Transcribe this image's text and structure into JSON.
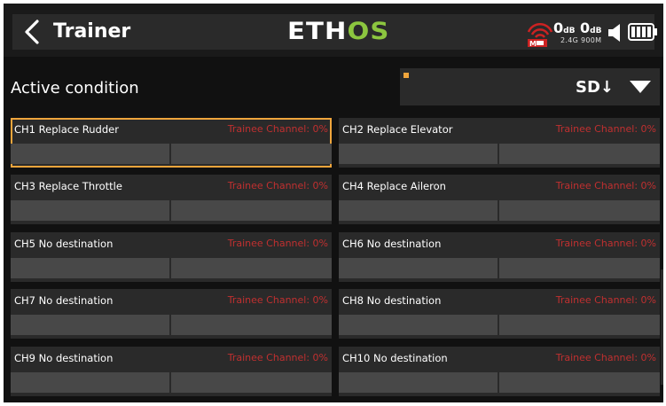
{
  "header": {
    "title": "Trainer",
    "logo_part1": "ETH",
    "logo_part2": "OS",
    "rx1_db_value": "0",
    "rx1_db_unit": "dB",
    "rx2_db_value": "0",
    "rx2_db_unit": "dB",
    "rx_bands": "2.4G 900M",
    "icons": [
      "back-arrow-icon",
      "signal-icon",
      "speaker-icon",
      "battery-icon"
    ]
  },
  "condition": {
    "label": "Active condition",
    "value": "SD↓"
  },
  "colors": {
    "accent": "#f0a53c",
    "trainee_text": "#c03030",
    "logo_green": "#8cc63f",
    "card_bg": "#2a2a2a",
    "bar_bg": "#484848"
  },
  "channels": [
    {
      "label": "CH1 Replace Rudder",
      "trainee": "Trainee Channel: 0%",
      "selected": true
    },
    {
      "label": "CH2 Replace Elevator",
      "trainee": "Trainee Channel: 0%"
    },
    {
      "label": "CH3 Replace Throttle",
      "trainee": "Trainee Channel: 0%"
    },
    {
      "label": "CH4 Replace Aileron",
      "trainee": "Trainee Channel: 0%"
    },
    {
      "label": "CH5 No destination",
      "trainee": "Trainee Channel: 0%"
    },
    {
      "label": "CH6 No destination",
      "trainee": "Trainee Channel: 0%"
    },
    {
      "label": "CH7 No destination",
      "trainee": "Trainee Channel: 0%"
    },
    {
      "label": "CH8 No destination",
      "trainee": "Trainee Channel: 0%"
    },
    {
      "label": "CH9 No destination",
      "trainee": "Trainee Channel: 0%"
    },
    {
      "label": "CH10 No destination",
      "trainee": "Trainee Channel: 0%"
    }
  ]
}
